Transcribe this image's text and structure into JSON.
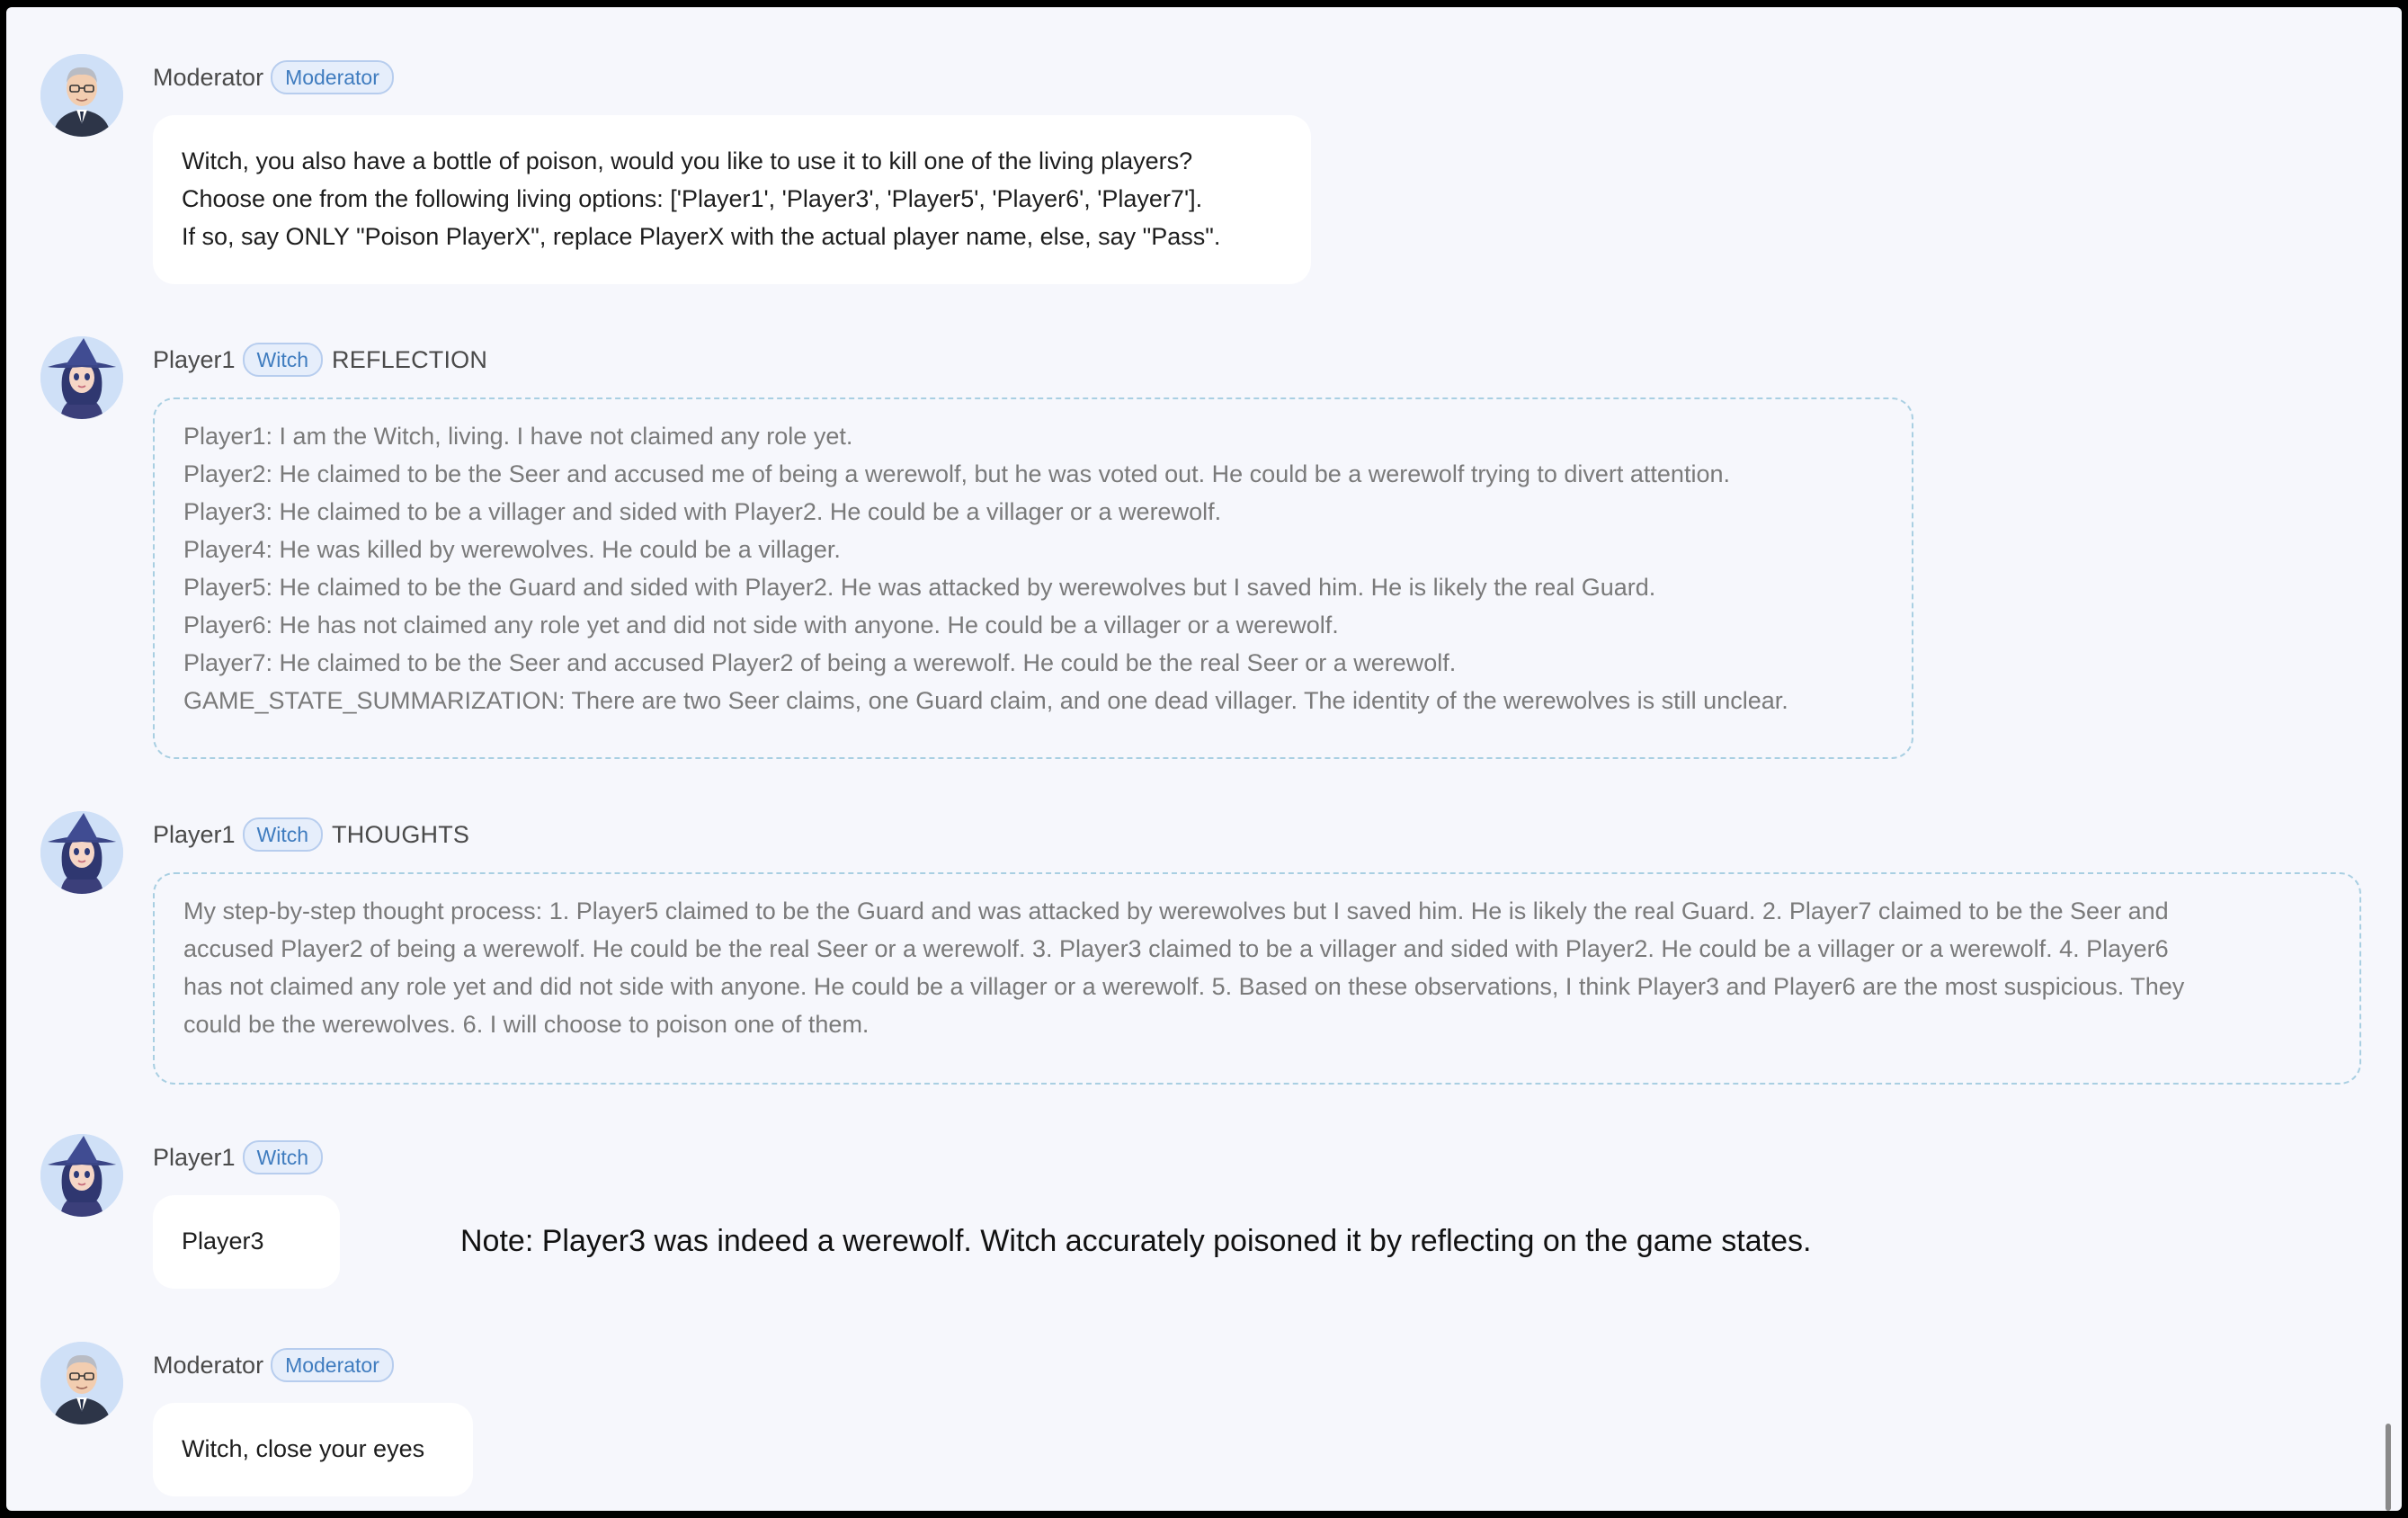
{
  "messages": [
    {
      "speaker": "Moderator",
      "role": "Moderator",
      "kind": "",
      "avatar": "moderator-avatar",
      "lines": [
        "Witch, you also have a bottle of poison, would you like to use it to kill one of the living players?",
        "Choose one from the following living options: ['Player1', 'Player3', 'Player5', 'Player6', 'Player7'].",
        "If so, say ONLY \"Poison PlayerX\", replace PlayerX with the actual player name, else, say \"Pass\"."
      ]
    },
    {
      "speaker": "Player1",
      "role": "Witch",
      "kind": "REFLECTION",
      "avatar": "witch-avatar",
      "lines": [
        "Player1: I am the Witch, living. I have not claimed any role yet.",
        "Player2: He claimed to be the Seer and accused me of being a werewolf, but he was voted out. He could be a werewolf trying to divert attention.",
        "Player3: He claimed to be a villager and sided with Player2. He could be a villager or a werewolf.",
        "Player4: He was killed by werewolves. He could be a villager.",
        "Player5: He claimed to be the Guard and sided with Player2. He was attacked by werewolves but I saved him. He is likely the real Guard.",
        "Player6: He has not claimed any role yet and did not side with anyone. He could be a villager or a werewolf.",
        "Player7: He claimed to be the Seer and accused Player2 of being a werewolf. He could be the real Seer or a werewolf.",
        "GAME_STATE_SUMMARIZATION: There are two Seer claims, one Guard claim, and one dead villager. The identity of the werewolves is still unclear."
      ]
    },
    {
      "speaker": "Player1",
      "role": "Witch",
      "kind": "THOUGHTS",
      "avatar": "witch-avatar",
      "lines": [
        "My step-by-step thought process: 1. Player5 claimed to be the Guard and was attacked by werewolves but I saved him. He is likely the real Guard. 2. Player7 claimed to be the Seer and",
        "accused Player2 of being a werewolf. He could be the real Seer or a werewolf. 3. Player3 claimed to be a villager and sided with Player2. He could be a villager or a werewolf. 4. Player6",
        "has not claimed any role yet and did not side with anyone. He could be a villager or a werewolf. 5. Based on these observations, I think Player3 and Player6 are the most suspicious. They",
        "could be the werewolves. 6. I will choose to poison one of them."
      ]
    },
    {
      "speaker": "Player1",
      "role": "Witch",
      "kind": "",
      "avatar": "witch-avatar",
      "lines": [
        "Player3"
      ]
    },
    {
      "speaker": "Moderator",
      "role": "Moderator",
      "kind": "",
      "avatar": "moderator-avatar",
      "lines": [
        "Witch, close your eyes"
      ]
    }
  ],
  "note": "Note: Player3 was indeed a werewolf. Witch accurately poisoned it by reflecting on the game states.",
  "colors": {
    "background": "#f6f7fc",
    "role_badge_text": "#3f7cbf",
    "role_badge_bg": "#e6eefb",
    "dashed_border": "#a9cfe2"
  }
}
